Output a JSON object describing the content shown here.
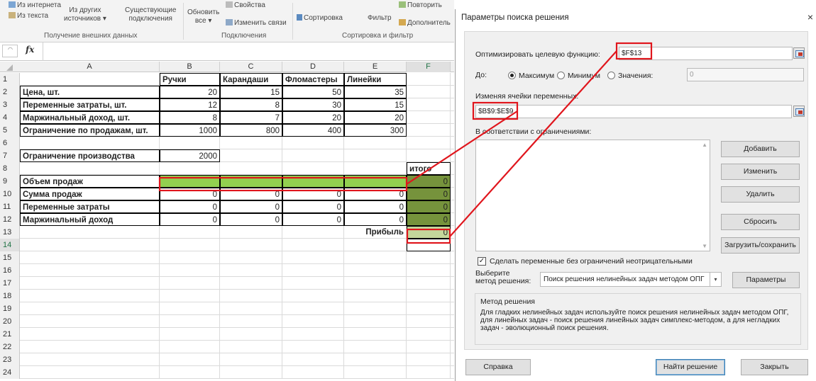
{
  "ribbon": {
    "from_internet": "Из интернета",
    "from_text": "Из текста",
    "other_sources_1": "Из других",
    "other_sources_2": "источников",
    "existing_1": "Существующие",
    "existing_2": "подключения",
    "refresh_1": "Обновить",
    "refresh_2": "все",
    "properties": "Свойства",
    "edit_links": "Изменить связи",
    "sort": "Сортировка",
    "filter": "Фильтр",
    "reapply": "Повторить",
    "advanced": "Дополнитель",
    "group_external": "Получение внешних данных",
    "group_connections": "Подключения",
    "group_sort": "Сортировка и фильтр"
  },
  "formula_bar": {
    "fx": "fx"
  },
  "sheet": {
    "columns": [
      "A",
      "B",
      "C",
      "D",
      "E",
      "F"
    ],
    "row_numbers": [
      "1",
      "2",
      "3",
      "4",
      "5",
      "6",
      "7",
      "8",
      "9",
      "10",
      "11",
      "12",
      "13",
      "14",
      "15",
      "16",
      "17",
      "18",
      "19",
      "20",
      "21",
      "22",
      "23",
      "24"
    ],
    "headers": {
      "b": "Ручки",
      "c": "Карандаши",
      "d": "Фломастеры",
      "e": "Линейки"
    },
    "labels": {
      "r2": "Цена, шт.",
      "r3": "Переменные затраты, шт.",
      "r4": "Маржинальный доход, шт.",
      "r5": "Ограничение по продажам, шт.",
      "r7": "Ограничение производства",
      "r8f": "итого",
      "r9": "Объем продаж",
      "r10": "Сумма продаж",
      "r11": "Переменные затраты",
      "r12": "Маржинальный доход",
      "r13e": "Прибыль"
    },
    "values": {
      "r2": [
        "20",
        "15",
        "50",
        "35"
      ],
      "r3": [
        "12",
        "8",
        "30",
        "15"
      ],
      "r4": [
        "8",
        "7",
        "20",
        "20"
      ],
      "r5": [
        "1000",
        "800",
        "400",
        "300"
      ],
      "r7b": "2000",
      "r10": [
        "0",
        "0",
        "0",
        "0",
        "0"
      ],
      "r11": [
        "0",
        "0",
        "0",
        "0",
        "0"
      ],
      "r12": [
        "0",
        "0",
        "0",
        "0",
        "0"
      ],
      "r9f": "0",
      "r13f": "0"
    }
  },
  "dialog": {
    "title": "Параметры поиска решения",
    "close": "×",
    "objective_label": "Оптимизировать целевую функцию:",
    "objective_value": "$F$13",
    "to_label": "До:",
    "radio_max": "Максимум",
    "radio_min": "Минимум",
    "radio_value": "Значения:",
    "value_input": "0",
    "changing_label": "Изменяя ячейки переменных:",
    "changing_value": "$B$9:$E$9",
    "constraints_label": "В соответствии с ограничениями:",
    "btn_add": "Добавить",
    "btn_change": "Изменить",
    "btn_delete": "Удалить",
    "btn_reset": "Сбросить",
    "btn_load_save": "Загрузить/сохранить",
    "nonneg_label": "Сделать переменные без ограничений неотрицательными",
    "nonneg_checked": "✓",
    "select_method_label_1": "Выберите",
    "select_method_label_2": "метод решения:",
    "method_value": "Поиск решения нелинейных задач методом ОПГ",
    "btn_params": "Параметры",
    "method_group_title": "Метод решения",
    "method_desc": "Для гладких нелинейных задач используйте поиск решения нелинейных задач методом ОПГ, для линейных задач - поиск решения линейных задач симплекс-методом, а для негладких задач - эволюционный поиск решения.",
    "btn_help": "Справка",
    "btn_solve": "Найти решение",
    "btn_close": "Закрыть"
  },
  "colors": {
    "volume_green": "#92d050",
    "total_green": "#76933c",
    "profit_green": "#c4d79b",
    "annotation_red": "#e0161d"
  }
}
